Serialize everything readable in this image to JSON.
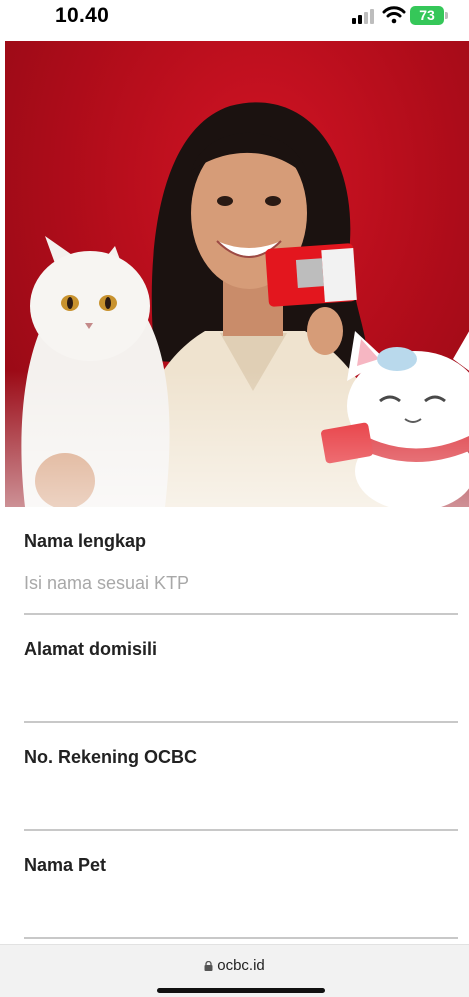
{
  "status_bar": {
    "time": "10.40",
    "battery": "73"
  },
  "form": {
    "fields": [
      {
        "label": "Nama lengkap",
        "placeholder": "Isi nama sesuai KTP",
        "value": ""
      },
      {
        "label": "Alamat domisili",
        "placeholder": "",
        "value": ""
      },
      {
        "label": "No. Rekening OCBC",
        "placeholder": "",
        "value": ""
      },
      {
        "label": "Nama Pet",
        "placeholder": "",
        "value": ""
      }
    ]
  },
  "url_bar": {
    "domain": "ocbc.id"
  },
  "colors": {
    "brand_red": "#b40d1b",
    "battery_green": "#35c759"
  },
  "hero": {
    "image": "promo-woman-with-cat-and-ocbc-card"
  }
}
